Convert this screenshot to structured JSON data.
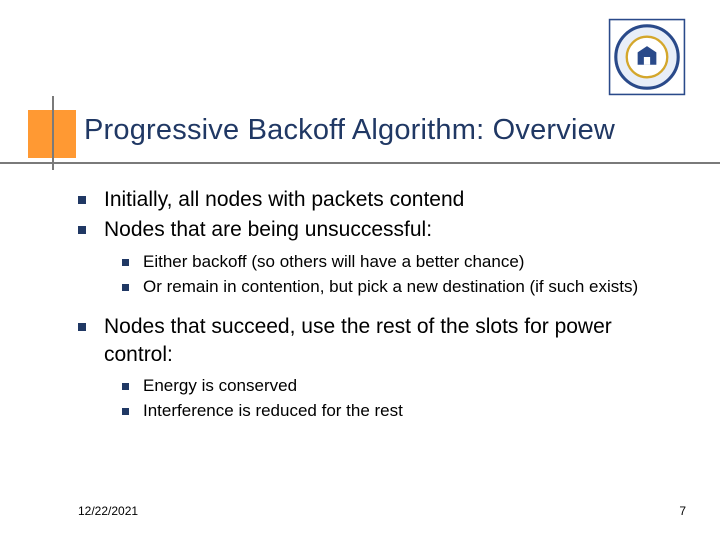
{
  "title": "Progressive Backoff Algorithm: Overview",
  "bullets": {
    "b1": "Initially, all nodes with packets contend",
    "b2": "Nodes that are being unsuccessful:",
    "b2_sub": {
      "s1": "Either backoff (so others will have a better chance)",
      "s2": "Or remain in contention, but pick a new destination (if such exists)"
    },
    "b3": "Nodes that succeed, use the rest of the slots for power control:",
    "b3_sub": {
      "s1": "Energy is conserved",
      "s2": "Interference is reduced for the rest"
    }
  },
  "footer": {
    "date": "12/22/2021",
    "page": "7"
  },
  "logo": {
    "name": "university-crest-icon"
  }
}
